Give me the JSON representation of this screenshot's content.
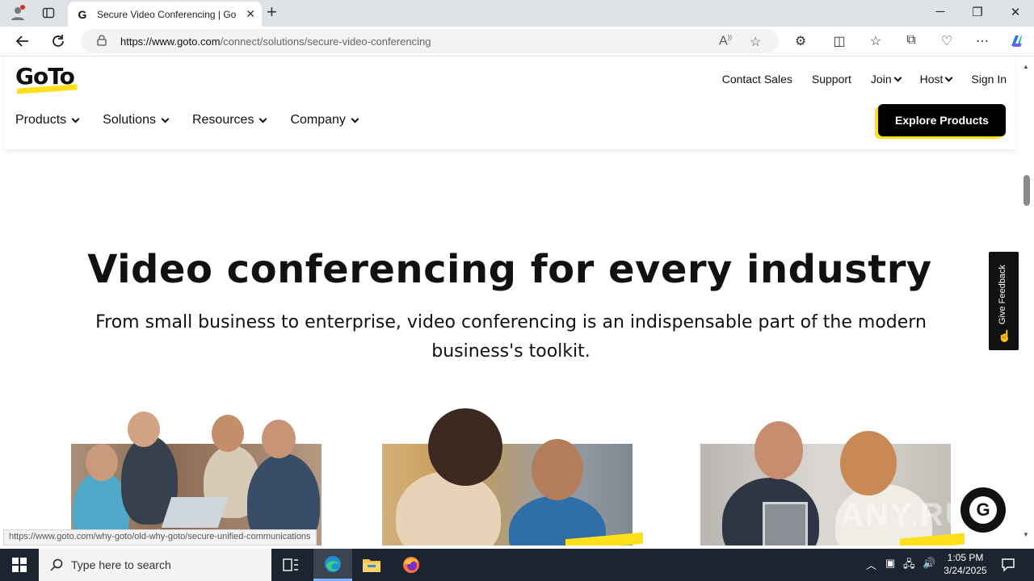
{
  "browser": {
    "tab_title": "Secure Video Conferencing | GoTo",
    "new_tab_symbol": "+",
    "url_host": "https://www.goto.com",
    "url_path": "/connect/solutions/secure-video-conferencing"
  },
  "site": {
    "logo_text": "GoTo",
    "util_nav": [
      "Contact Sales",
      "Support",
      "Join",
      "Host",
      "Sign In"
    ],
    "main_nav": [
      "Products",
      "Solutions",
      "Resources",
      "Company"
    ],
    "cta_label": "Explore Products",
    "brand_color": "#ffe01b"
  },
  "hero": {
    "headline": "Video conferencing for every industry",
    "subline": "From small business to enterprise, video conferencing is an indispensable part of the modern business's toolkit."
  },
  "feedback_label": "Give Feedback",
  "status_bar_url": "https://www.goto.com/why-goto/old-why-goto/secure-unified-communications",
  "chat_badge_letter": "G",
  "watermark_text": "ANY.RUN",
  "taskbar": {
    "search_placeholder": "Type here to search",
    "time": "1:05 PM",
    "date": "3/24/2025"
  }
}
